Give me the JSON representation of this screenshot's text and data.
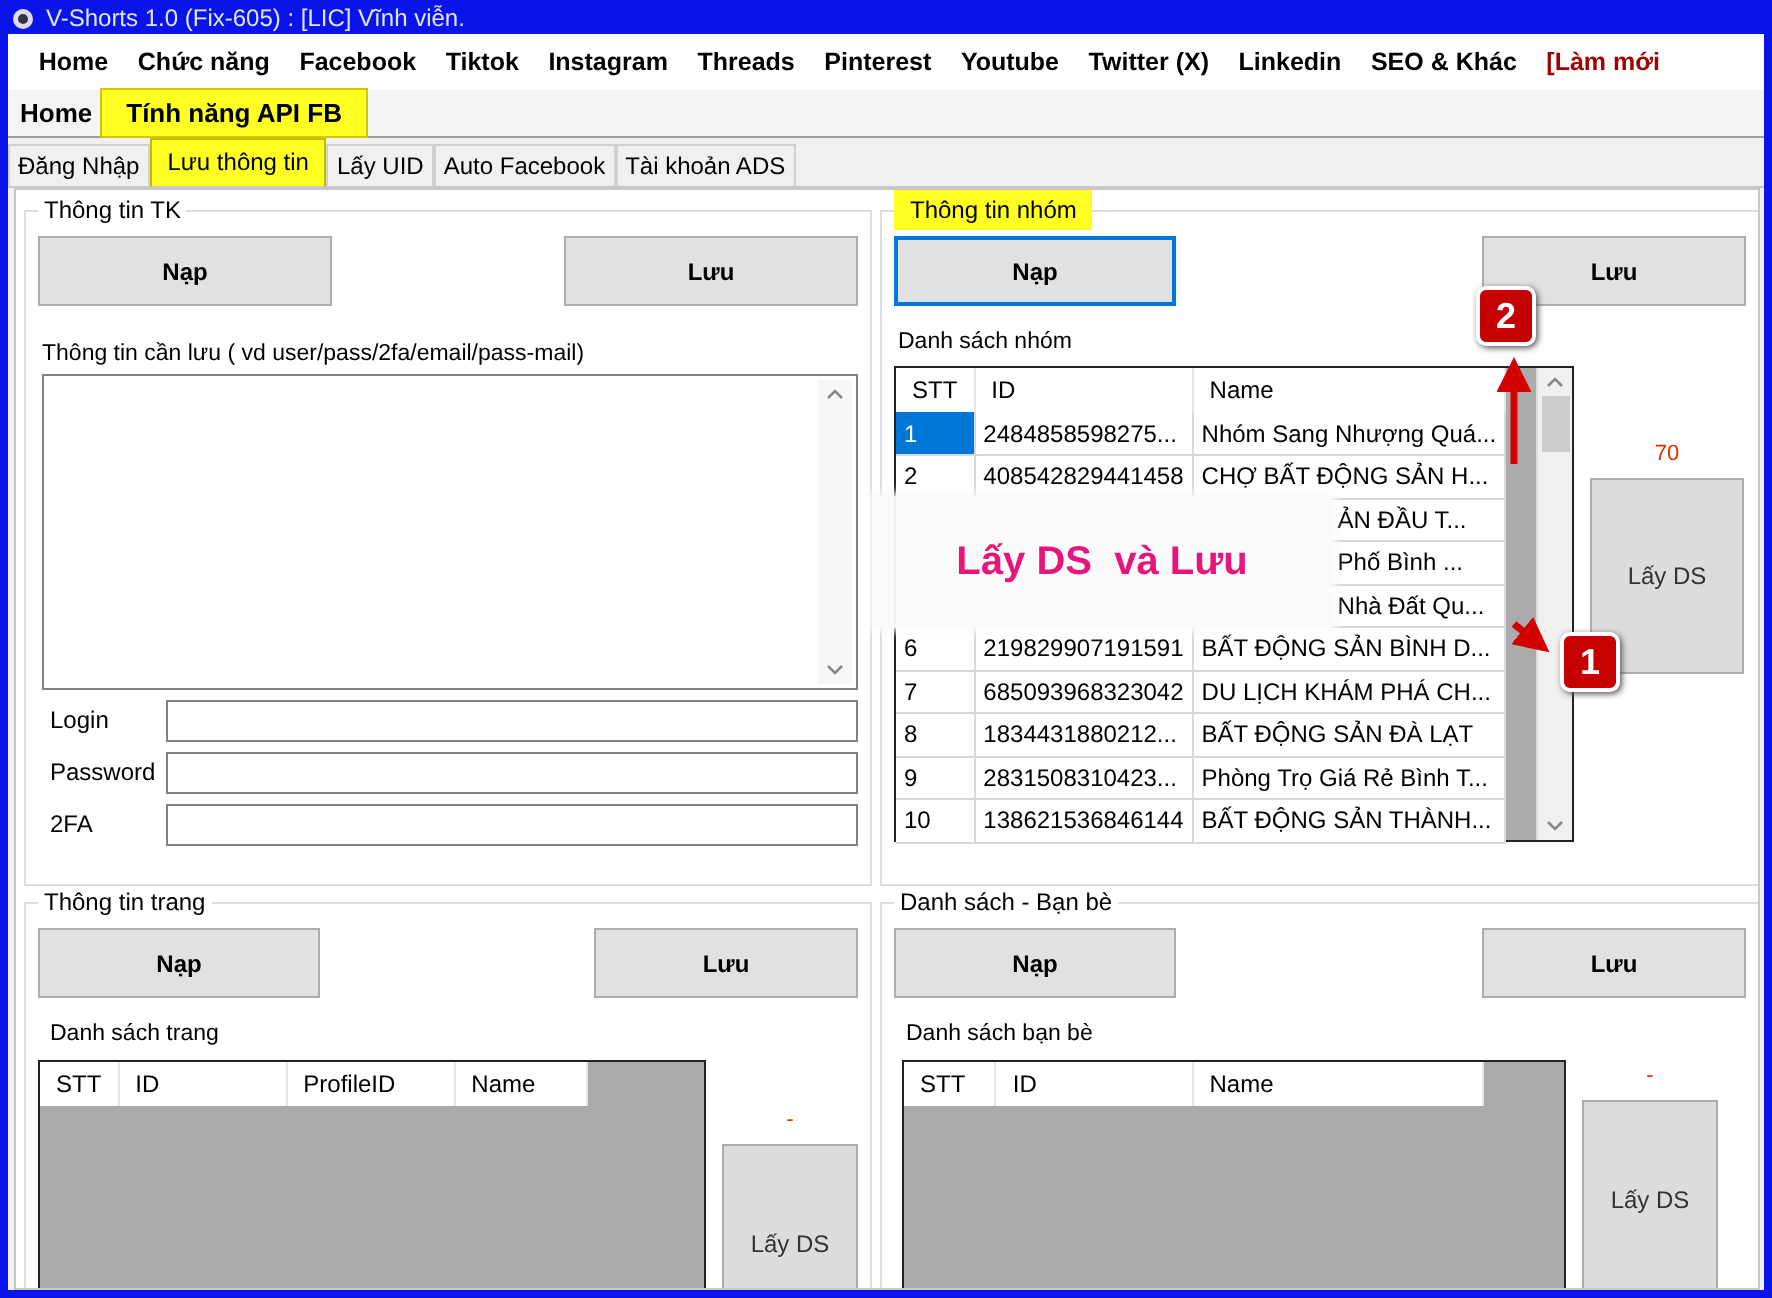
{
  "title_bar": {
    "title": "V-Shorts 1.0 (Fix-605) : [LIC] Vĩnh viễn."
  },
  "menu_bar": [
    {
      "label": "Home",
      "kind": "normal"
    },
    {
      "label": "Chức năng",
      "kind": "normal"
    },
    {
      "label": "Facebook",
      "kind": "normal"
    },
    {
      "label": "Tiktok",
      "kind": "normal"
    },
    {
      "label": "Instagram",
      "kind": "normal"
    },
    {
      "label": "Threads",
      "kind": "normal"
    },
    {
      "label": "Pinterest",
      "kind": "normal"
    },
    {
      "label": "Youtube",
      "kind": "normal"
    },
    {
      "label": "Twitter (X)",
      "kind": "normal"
    },
    {
      "label": "Linkedin",
      "kind": "normal"
    },
    {
      "label": "SEO & Khác",
      "kind": "normal"
    },
    {
      "label": "[Làm mới",
      "kind": "accent"
    }
  ],
  "ribbon_tabs": [
    {
      "label": "Home",
      "selected": false
    },
    {
      "label": "Tính năng API FB",
      "selected": true
    }
  ],
  "sub_tabs": [
    {
      "label": "Đăng Nhập",
      "selected": false
    },
    {
      "label": "Lưu thông tin",
      "selected": true
    },
    {
      "label": "Lấy UID",
      "selected": false
    },
    {
      "label": "Auto Facebook",
      "selected": false
    },
    {
      "label": "Tài khoản ADS",
      "selected": false
    }
  ],
  "account_info": {
    "title": "Thông tin TK",
    "highlighted": false,
    "load_button": "Nạp",
    "save_button": "Lưu",
    "note_label": "Thông tin cần lưu ( vd user/pass/2fa/email/pass-mail)",
    "fields": [
      {
        "label": "Login"
      },
      {
        "label": "Password"
      },
      {
        "label": "2FA"
      }
    ]
  },
  "group_info": {
    "title": "Thông tin nhóm",
    "highlighted": true,
    "load_button": "Nạp",
    "save_button": "Lưu",
    "list_label": "Danh sách nhóm",
    "count": "70",
    "fetch_button": "Lấy DS",
    "columns": [
      "STT",
      "ID",
      "Name"
    ],
    "rows": [
      {
        "kind": "full",
        "stt": "1",
        "id": "2484858598275...",
        "name": "Nhóm Sang Nhượng Quá...",
        "selected": true
      },
      {
        "kind": "full",
        "stt": "2",
        "id": "408542829441458",
        "name": "CHỢ BẤT ĐỘNG SẢN H...",
        "selected": false
      },
      {
        "kind": "partial",
        "name": "ẢN ĐẦU T...",
        "selected": false
      },
      {
        "kind": "partial",
        "name": "Phố Bình ...",
        "selected": false
      },
      {
        "kind": "partial",
        "name": "Nhà Đất Qu...",
        "selected": false
      },
      {
        "kind": "full",
        "stt": "6",
        "id": "219829907191591",
        "name": "BẤT ĐỘNG SẢN BÌNH D...",
        "selected": false
      },
      {
        "kind": "full",
        "stt": "7",
        "id": "685093968323042",
        "name": "DU LỊCH KHÁM PHÁ CH...",
        "selected": false
      },
      {
        "kind": "full",
        "stt": "8",
        "id": "1834431880212...",
        "name": "BẤT ĐỘNG SẢN ĐÀ LẠT",
        "selected": false
      },
      {
        "kind": "full",
        "stt": "9",
        "id": "2831508310423...",
        "name": "Phòng Trọ Giá Rẻ Bình T...",
        "selected": false
      },
      {
        "kind": "full",
        "stt": "10",
        "id": "138621536846144",
        "name": "BẤT ĐỘNG SẢN THÀNH...",
        "selected": false
      }
    ]
  },
  "page_info": {
    "title": "Thông tin trang",
    "highlighted": false,
    "load_button": "Nạp",
    "save_button": "Lưu",
    "list_label": "Danh sách trang",
    "count": "-",
    "fetch_button": "Lấy DS",
    "columns": [
      "STT",
      "ID",
      "ProfileID",
      "Name"
    ]
  },
  "friends": {
    "title": "Danh sách - Bạn bè",
    "highlighted": false,
    "load_button": "Nạp",
    "save_button": "Lưu",
    "list_label": "Danh sách bạn bè",
    "count": "-",
    "fetch_button": "Lấy DS",
    "columns": [
      "STT",
      "ID",
      "Name"
    ]
  },
  "annotation": {
    "text": "Lấy DS  và Lưu",
    "markers": [
      {
        "label": "1"
      },
      {
        "label": "2"
      }
    ]
  }
}
